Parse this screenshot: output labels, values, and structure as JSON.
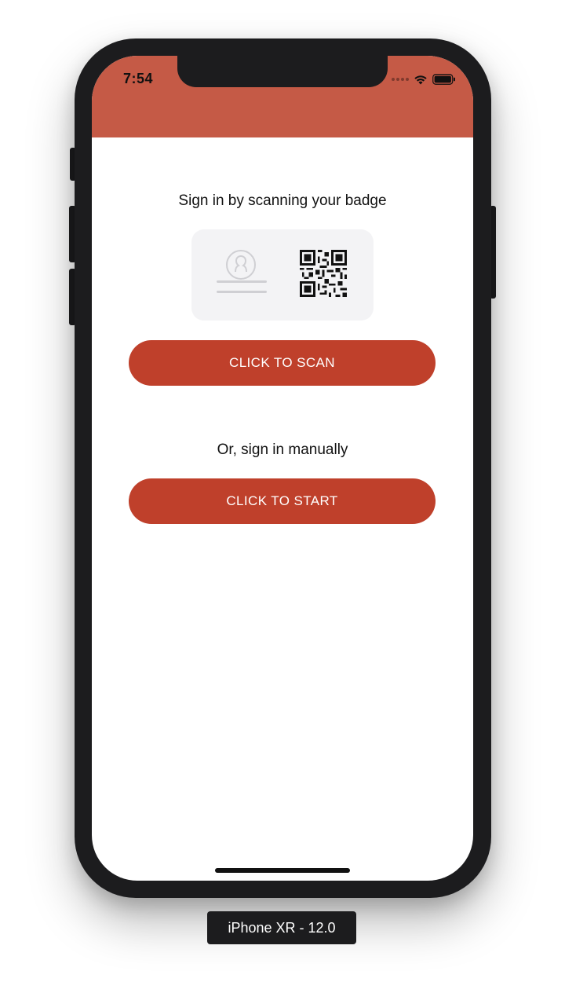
{
  "status_bar": {
    "time": "7:54",
    "icons": [
      "signal-dots-icon",
      "wifi-icon",
      "battery-icon"
    ]
  },
  "colors": {
    "header": "#c55a46",
    "button": "#bf402b",
    "card": "#f3f3f5",
    "device_frame": "#1c1c1e"
  },
  "scan_section": {
    "heading": "Sign in by scanning your badge",
    "badge_illustration_icons": [
      "avatar-icon",
      "qr-code-icon"
    ],
    "button_label": "CLICK TO SCAN"
  },
  "manual_section": {
    "heading": "Or, sign in manually",
    "button_label": "CLICK TO START"
  },
  "device_label": "iPhone XR - 12.0"
}
